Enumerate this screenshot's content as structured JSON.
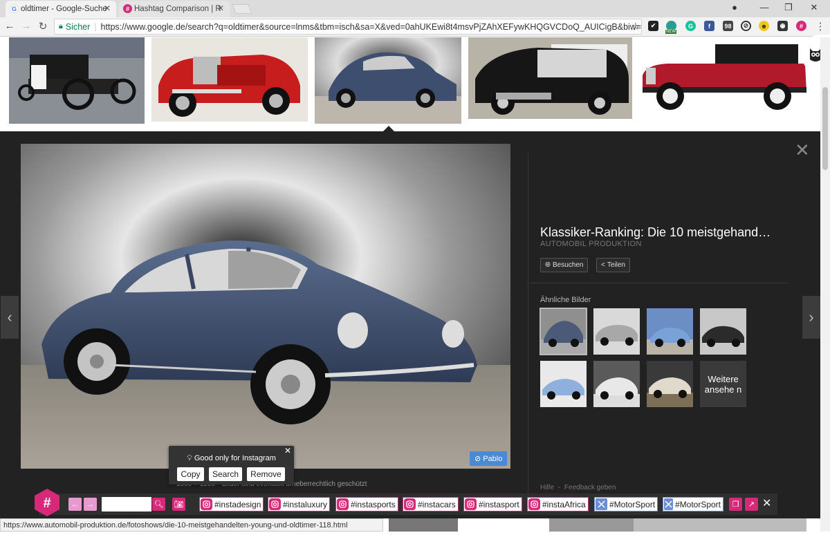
{
  "browser": {
    "tabs": [
      {
        "title": "oldtimer - Google-Suche",
        "active": true
      },
      {
        "title": "Hashtag Comparison | R",
        "active": false
      }
    ],
    "secure_label": "Sicher",
    "url": "https://www.google.de/search?q=oldtimer&source=lnms&tbm=isch&sa=X&ved=0ahUKEwi8t4msvPjZAhXEFywKHQGVCDoQ_AUICigB&biw=144...",
    "extensions": [
      "check-extension-icon",
      "new-extension-icon",
      "grammarly-icon",
      "facebook-icon",
      "badge-98-icon",
      "ghostery-icon",
      "emoji-icon",
      "hootsuite-owl-icon",
      "hashtag-icon"
    ],
    "ext_badge": "NEW",
    "ext_count": "98",
    "status_url": "https://www.automobil-produktion.de/fotoshows/die-10-meistgehandelten-young-und-oldtimer-118.html"
  },
  "viewer": {
    "title": "Klassiker-Ranking: Die 10 meistgehand…",
    "source": "AUTOMOBIL PRODUKTION",
    "visit_label": "Besuchen",
    "share_label": "Teilen",
    "similar_label": "Ähnliche Bilder",
    "more_label": "Weitere ansehe n",
    "caption": "Bilder sind eventuell urheberrechtlich geschützt",
    "caption_prefix": "1800 × 1200 ·",
    "help_label": "Hilfe",
    "feedback_label": "Feedback geben",
    "pablo_label": "Pablo"
  },
  "popover": {
    "tip": "Good only for Instagram",
    "copy": "Copy",
    "search": "Search",
    "remove": "Remove"
  },
  "hashtag_bar": {
    "search_placeholder": "",
    "tags": [
      {
        "text": "#instadesign",
        "network": "instagram"
      },
      {
        "text": "#instaluxury",
        "network": "instagram"
      },
      {
        "text": "#instasports",
        "network": "instagram"
      },
      {
        "text": "#instacars",
        "network": "instagram"
      },
      {
        "text": "#instasport",
        "network": "instagram"
      },
      {
        "text": "#instaAfrica",
        "network": "instagram"
      },
      {
        "text": "#MotorSport",
        "network": "twitter"
      },
      {
        "text": "#MotorSport",
        "network": "twitter"
      }
    ]
  },
  "colors": {
    "accent_pink": "#d6297a",
    "viewer_bg": "#222222",
    "pablo_blue": "#4a8ad4",
    "secure_green": "#0b8043"
  }
}
